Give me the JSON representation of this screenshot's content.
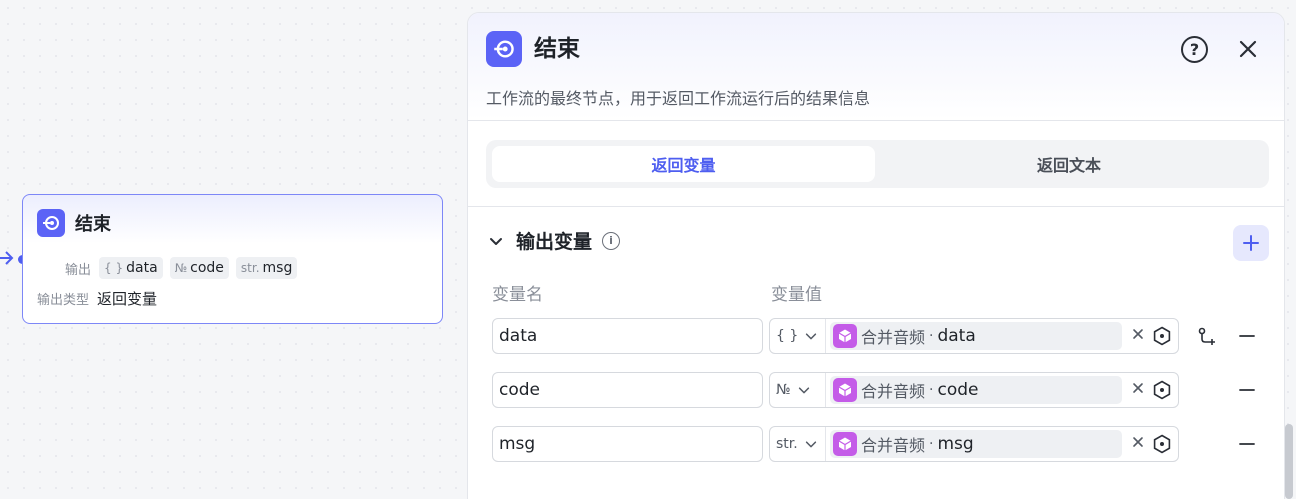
{
  "canvas_node": {
    "title": "结束",
    "output_label": "输出",
    "outputs": [
      {
        "type_icon": "{ }",
        "name": "data"
      },
      {
        "type_icon": "№",
        "name": "code"
      },
      {
        "type_icon": "str.",
        "name": "msg"
      }
    ],
    "output_type_label": "输出类型",
    "output_type_value": "返回变量"
  },
  "panel": {
    "title": "结束",
    "description": "工作流的最终节点，用于返回工作流运行后的结果信息",
    "tabs": [
      {
        "label": "返回变量",
        "active": true
      },
      {
        "label": "返回文本",
        "active": false
      }
    ],
    "section_title": "输出变量",
    "columns": {
      "name": "变量名",
      "value": "变量值"
    },
    "variables": [
      {
        "name": "data",
        "type_icon": "{ }",
        "source": "合并音频",
        "separator": "·",
        "ref": "data"
      },
      {
        "name": "code",
        "type_icon": "№",
        "source": "合并音频",
        "separator": "·",
        "ref": "code"
      },
      {
        "name": "msg",
        "type_icon": "str.",
        "source": "合并音频",
        "separator": "·",
        "ref": "msg"
      }
    ]
  },
  "colors": {
    "accent": "#4e5ef0",
    "node_icon_bg": "#5b63f6",
    "source_cube": "#c45ce8"
  },
  "icons": {
    "end_node": "exit-arrow-circle-icon",
    "help": "question-circle-icon",
    "close": "close-icon",
    "collapse": "chevron-down-icon",
    "info": "info-circle-icon",
    "add": "plus-icon",
    "source": "cube-icon",
    "clear": "x-icon",
    "picker": "hexagon-target-icon",
    "link": "branch-link-icon",
    "remove": "minus-icon"
  }
}
